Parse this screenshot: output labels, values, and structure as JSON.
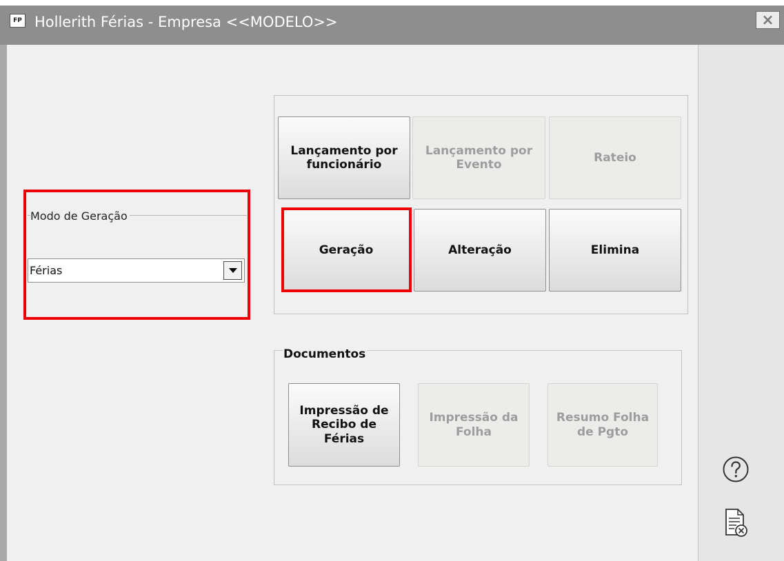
{
  "window": {
    "app_icon_label": "FP",
    "title": "Hollerith Férias - Empresa <<MODELO>>",
    "close_symbol": "×"
  },
  "modo_geracao": {
    "legend": "Modo de Geração",
    "selected_value": "Férias"
  },
  "lancamentos": {
    "buttons": [
      {
        "label": "Lançamento por funcionário",
        "enabled": true
      },
      {
        "label": "Lançamento por Evento",
        "enabled": false
      },
      {
        "label": "Rateio",
        "enabled": false
      },
      {
        "label": "Geração",
        "enabled": true,
        "highlighted": true
      },
      {
        "label": "Alteração",
        "enabled": true
      },
      {
        "label": "Elimina",
        "enabled": true
      }
    ]
  },
  "documentos": {
    "legend": "Documentos",
    "buttons": [
      {
        "label": "Impressão de Recibo de Férias",
        "enabled": true
      },
      {
        "label": "Impressão da Folha",
        "enabled": false
      },
      {
        "label": "Resumo Folha de Pgto",
        "enabled": false
      }
    ]
  },
  "side_icons": [
    "help-icon",
    "document-close-icon"
  ],
  "colors": {
    "titlebar": "#8e8e8e",
    "highlight": "#ee0000",
    "disabled_text": "#9d9d9d"
  }
}
